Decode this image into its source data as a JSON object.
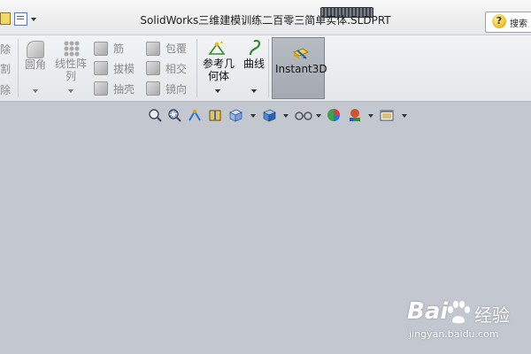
{
  "titlebar": {
    "title": "SolidWorks三维建模训练二百零三简单实体.SLDPRT",
    "search_label": "搜索",
    "help_glyph": "?"
  },
  "ribbon": {
    "left_partial": [
      "除",
      "割",
      "除"
    ],
    "fillet": "圆角",
    "linear_pattern_1": "线性阵",
    "linear_pattern_2": "列",
    "rib": "筋",
    "draft": "拔模",
    "shell": "抽壳",
    "wrap": "包覆",
    "intersect": "相交",
    "mirror": "镜向",
    "ref_geometry_1": "参考几",
    "ref_geometry_2": "何体",
    "curves": "曲线",
    "instant3d": "Instant3D"
  },
  "watermark": {
    "brand_1": "Bai",
    "brand_2": "经验",
    "url": "jingyan.baidu.com"
  },
  "colors": {
    "viewport": "#c3c8d0",
    "ribbon": "#e9eaed",
    "instant3d_active": "#a9adb5"
  }
}
